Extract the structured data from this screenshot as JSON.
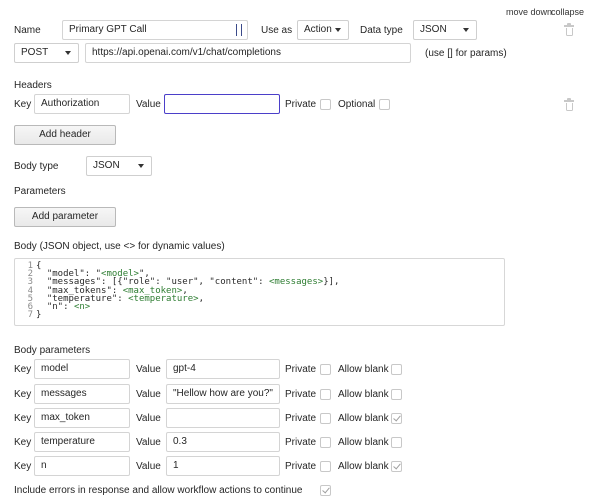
{
  "top_actions": {
    "move_down": "move down",
    "collapse": "collapse"
  },
  "call": {
    "name_label": "Name",
    "name_value": "Primary GPT Call",
    "use_as_label": "Use as",
    "use_as_value": "Action",
    "data_type_label": "Data type",
    "data_type_value": "JSON",
    "method_value": "POST",
    "url_value": "https://api.openai.com/v1/chat/completions",
    "url_hint": "(use [] for params)"
  },
  "headers": {
    "title": "Headers",
    "key_label": "Key",
    "key_value": "Authorization",
    "value_label": "Value",
    "value_value": "",
    "private_label": "Private",
    "optional_label": "Optional",
    "add_button": "Add header"
  },
  "body_type": {
    "label": "Body type",
    "value": "JSON"
  },
  "parameters": {
    "title": "Parameters",
    "add_button": "Add parameter"
  },
  "body": {
    "title": "Body (JSON object, use <> for dynamic values)",
    "lines": [
      {
        "num": "1",
        "a": "{",
        "b": "",
        "c": ""
      },
      {
        "num": "2",
        "a": "  \"model\": \"",
        "b": "<model>",
        "c": "\","
      },
      {
        "num": "3",
        "a": "  \"messages\": [{\"role\": \"user\", \"content\": ",
        "b": "<messages>",
        "c": "}],"
      },
      {
        "num": "4",
        "a": "  \"max_tokens\": ",
        "b": "<max_token>",
        "c": ","
      },
      {
        "num": "5",
        "a": "  \"temperature\": ",
        "b": "<temperature>",
        "c": ","
      },
      {
        "num": "6",
        "a": "  \"n\": ",
        "b": "<n>",
        "c": ""
      },
      {
        "num": "7",
        "a": "}",
        "b": "",
        "c": ""
      }
    ]
  },
  "body_params": {
    "title": "Body parameters",
    "key_label": "Key",
    "value_label": "Value",
    "private_label": "Private",
    "allow_blank_label": "Allow blank",
    "rows": [
      {
        "key": "model",
        "value": "gpt-4",
        "private": false,
        "allow_blank": false
      },
      {
        "key": "messages",
        "value": "\"Hellow how are you?\"",
        "private": false,
        "allow_blank": false
      },
      {
        "key": "max_token",
        "value": "",
        "private": false,
        "allow_blank": true
      },
      {
        "key": "temperature",
        "value": "0.3",
        "private": false,
        "allow_blank": false
      },
      {
        "key": "n",
        "value": "1",
        "private": false,
        "allow_blank": true
      }
    ]
  },
  "footer": {
    "include_errors_label": "Include errors in response and allow workflow actions to continue",
    "include_errors_checked": true
  },
  "colors": {
    "focus_border": "#4b3fc9",
    "code_value": "#2e7d32"
  }
}
